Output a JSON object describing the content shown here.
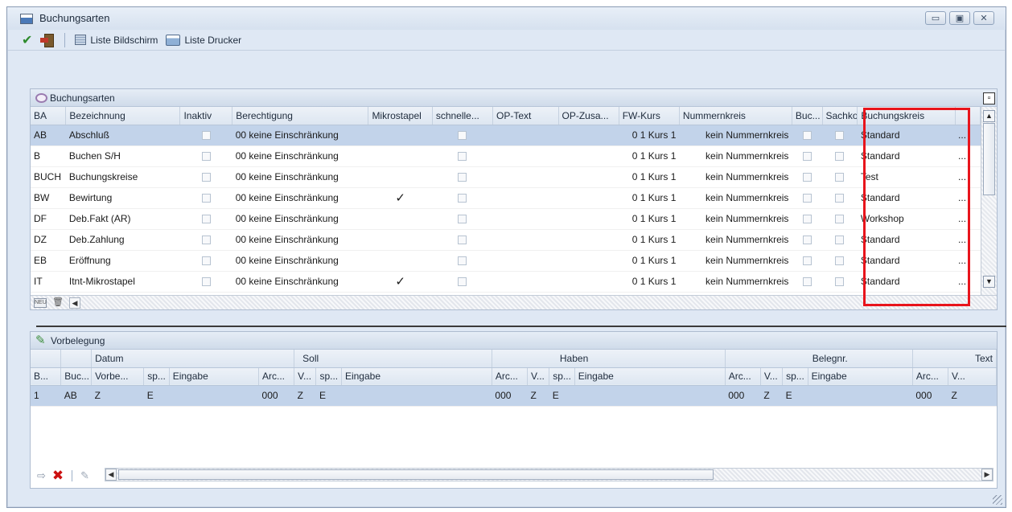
{
  "window": {
    "title": "Buchungsarten",
    "min_glyph": "▭",
    "max_glyph": "▣",
    "close_glyph": "✕"
  },
  "toolbar": {
    "screen_list_label": "Liste Bildschirm",
    "printer_list_label": "Liste Drucker"
  },
  "buchungsarten": {
    "panel_title": "Buchungsarten",
    "columns": [
      "BA",
      "Bezeichnung",
      "Inaktiv",
      "Berechtigung",
      "Mikrostapel",
      "schnelle...",
      "OP-Text",
      "OP-Zusa...",
      "FW-Kurs",
      "Nummernkreis",
      "Buc...",
      "Sachko...",
      "Buchungskreis"
    ],
    "more_glyph": "...",
    "rows": [
      {
        "ba": "AB",
        "bezeichnung": "Abschluß",
        "berechtigung": "00 keine Einschränkung",
        "mikrostapel": "",
        "fwkurs": "0 1 Kurs 1",
        "nummernkreis": "kein Nummernkreis",
        "buchungskreis": "Standard"
      },
      {
        "ba": "B",
        "bezeichnung": "Buchen S/H",
        "berechtigung": "00 keine Einschränkung",
        "mikrostapel": "",
        "fwkurs": "0 1 Kurs 1",
        "nummernkreis": "kein Nummernkreis",
        "buchungskreis": "Standard"
      },
      {
        "ba": "BUCH",
        "bezeichnung": "Buchungskreise",
        "berechtigung": "00 keine Einschränkung",
        "mikrostapel": "",
        "fwkurs": "0 1 Kurs 1",
        "nummernkreis": "kein Nummernkreis",
        "buchungskreis": "Test"
      },
      {
        "ba": "BW",
        "bezeichnung": "Bewirtung",
        "berechtigung": "00 keine Einschränkung",
        "mikrostapel": "✓",
        "fwkurs": "0 1 Kurs 1",
        "nummernkreis": "kein Nummernkreis",
        "buchungskreis": "Standard"
      },
      {
        "ba": "DF",
        "bezeichnung": "Deb.Fakt (AR)",
        "berechtigung": "00 keine Einschränkung",
        "mikrostapel": "",
        "fwkurs": "0 1 Kurs 1",
        "nummernkreis": "kein Nummernkreis",
        "buchungskreis": "Workshop"
      },
      {
        "ba": "DZ",
        "bezeichnung": "Deb.Zahlung",
        "berechtigung": "00 keine Einschränkung",
        "mikrostapel": "",
        "fwkurs": "0 1 Kurs 1",
        "nummernkreis": "kein Nummernkreis",
        "buchungskreis": "Standard"
      },
      {
        "ba": "EB",
        "bezeichnung": "Eröffnung",
        "berechtigung": "00 keine Einschränkung",
        "mikrostapel": "",
        "fwkurs": "0 1 Kurs 1",
        "nummernkreis": "kein Nummernkreis",
        "buchungskreis": "Standard"
      },
      {
        "ba": "IT",
        "bezeichnung": "Itnt-Mikrostapel",
        "berechtigung": "00 keine Einschränkung",
        "mikrostapel": "✓",
        "fwkurs": "0 1 Kurs 1",
        "nummernkreis": "kein Nummernkreis",
        "buchungskreis": "Standard"
      }
    ],
    "footer_icon_label": "NEU"
  },
  "vorbelegung": {
    "panel_title": "Vorbelegung",
    "groups": {
      "datum": "Datum",
      "soll": "Soll",
      "haben": "Haben",
      "belegnr": "Belegnr.",
      "text": "Text"
    },
    "columns": [
      "B...",
      "Buc...",
      "Vorbe...",
      "sp...",
      "Eingabe",
      "Arc...",
      "V...",
      "sp...",
      "Eingabe",
      "Arc...",
      "V...",
      "sp...",
      "Eingabe",
      "Arc...",
      "V...",
      "sp...",
      "Eingabe",
      "Arc...",
      "V..."
    ],
    "rows": [
      [
        "1",
        "AB",
        "Z",
        "E",
        "",
        "000",
        "Z",
        "E",
        "",
        "000",
        "Z",
        "E",
        "",
        "000",
        "Z",
        "E",
        "",
        "000",
        "Z"
      ]
    ]
  },
  "colors": {
    "highlight": "#e8141c",
    "selected_row": "#c2d3ea",
    "header": "#dde6f1"
  }
}
